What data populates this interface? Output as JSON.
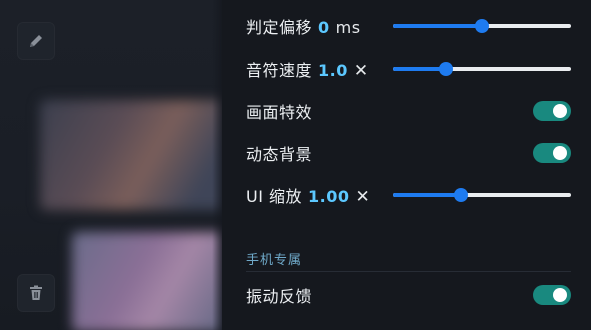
{
  "settings": {
    "offset": {
      "label": "判定偏移",
      "value": "0",
      "unit": "ms",
      "level": 0.5
    },
    "note_speed": {
      "label": "音符速度",
      "value": "1.0",
      "unit": "✕",
      "level": 0.3
    },
    "effects": {
      "label": "画面特效",
      "enabled": true
    },
    "dynamic_bg": {
      "label": "动态背景",
      "enabled": true
    },
    "ui_scale": {
      "label": "UI 缩放",
      "value": "1.00",
      "unit": "✕",
      "level": 0.38
    }
  },
  "mobile_section": {
    "title": "手机专属",
    "vibration": {
      "label": "振动反馈",
      "enabled": true
    }
  },
  "colors": {
    "accent_blue": "#1e7bf0",
    "value_text": "#5cc8ff",
    "toggle_on": "#19897f"
  },
  "icons": {
    "left_top": "pencil-icon",
    "left_bottom": "trash-icon"
  }
}
